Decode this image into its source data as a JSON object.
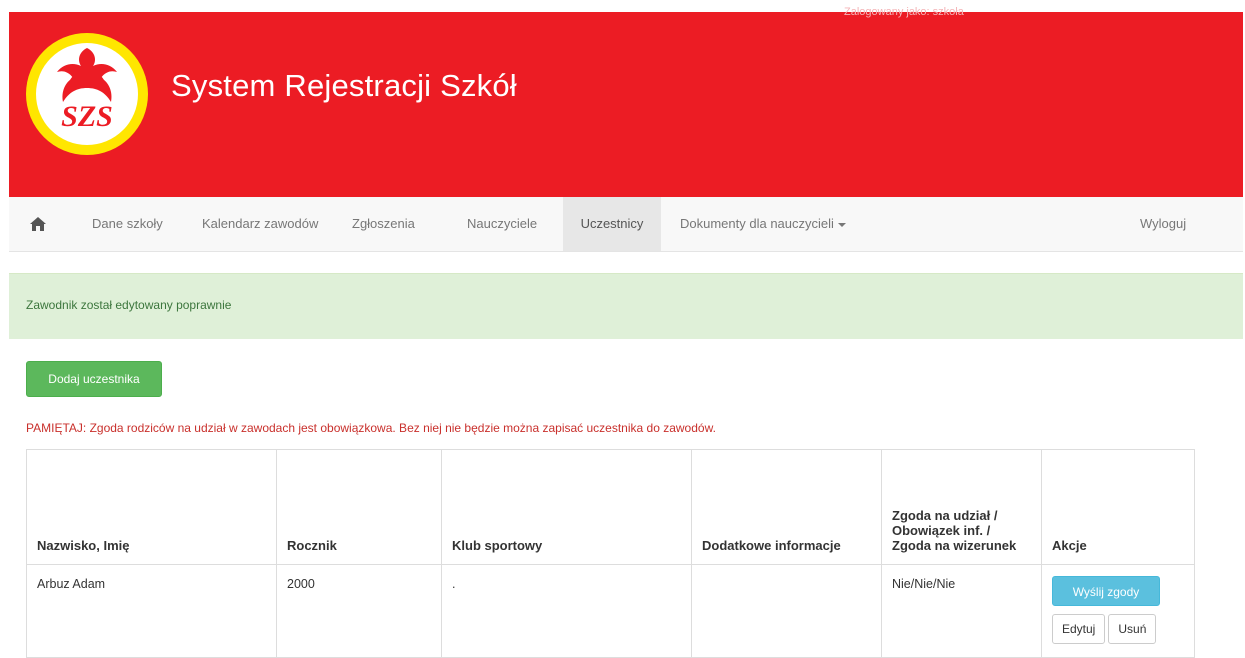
{
  "header": {
    "topline": "Zalogowany jako: szkoła",
    "title": "System Rejestracji Szkół",
    "logo_text": "SZS",
    "brand_color": "#ec1c24"
  },
  "nav": {
    "home_icon": "home-icon",
    "items": [
      {
        "label": "Dane szkoły"
      },
      {
        "label": "Kalendarz zawodów"
      },
      {
        "label": "Zgłoszenia"
      },
      {
        "label": "Nauczyciele"
      },
      {
        "label": "Uczestnicy"
      },
      {
        "label": "Dokumenty dla nauczycieli"
      }
    ],
    "active": "Uczestnicy",
    "logout": "Wyloguj"
  },
  "alert": {
    "text": "Zawodnik został edytowany poprawnie"
  },
  "add_button": "Dodaj uczestnika",
  "warning": "PAMIĘTAJ: Zgoda rodziców na udział w zawodach jest obowiązkowa. Bez niej nie będzie można zapisać uczestnika do zawodów.",
  "table": {
    "headers": [
      "Nazwisko, Imię",
      "Rocznik",
      "Klub sportowy",
      "Dodatkowe informacje",
      "Zgoda na udział / Obowiązek inf. / Zgoda na wizerunek",
      "Akcje"
    ],
    "rows": [
      {
        "name": "Arbuz Adam",
        "year": "2000",
        "club": ".",
        "info": "",
        "consents": "Nie/Nie/Nie",
        "send_label": "Wyślij zgody",
        "edit_label": "Edytuj",
        "delete_label": "Usuń"
      }
    ]
  }
}
